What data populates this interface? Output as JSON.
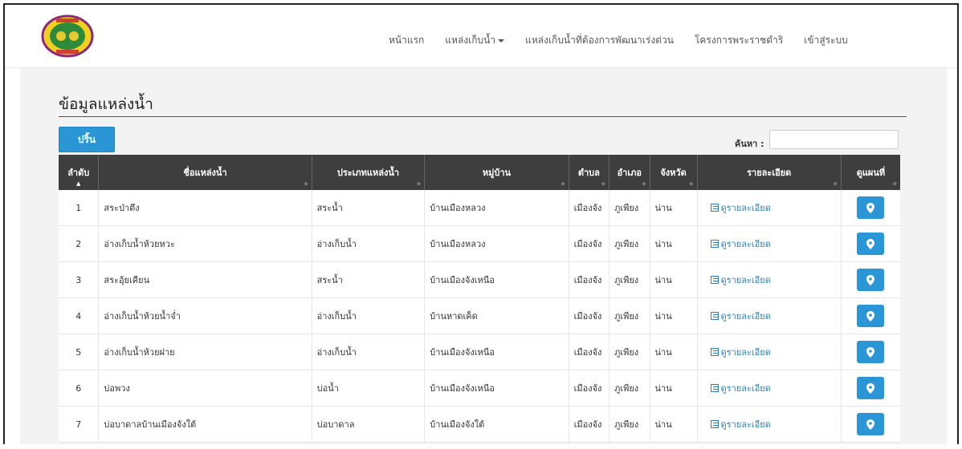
{
  "nav": {
    "items": [
      "หน้าแรก",
      "แหล่งเก็บน้ำ",
      "แหล่งเก็บน้ำที่ต้องการพัฒนาเร่งด่วน",
      "โครงการพระราชดำริ",
      "เข้าสู่ระบบ"
    ]
  },
  "page": {
    "title": "ข้อมูลแหล่งน้ำ",
    "print_label": "ปริ้น",
    "search_label": "ค้นหา :",
    "search_value": ""
  },
  "table": {
    "headers": [
      "ลำดับ",
      "ชื่อแหล่งน้ำ",
      "ประเภทแหล่งน้ำ",
      "หมู่บ้าน",
      "ตำบล",
      "อำเภอ",
      "จังหวัด",
      "รายละเอียด",
      "ดูแผนที่"
    ],
    "detail_label": "ดูรายละเอียด",
    "rows": [
      {
        "no": "1",
        "name": "สระป่าตึง",
        "type": "สระน้ำ",
        "village": "บ้านเมืองหลวง",
        "subdistrict": "เมืองจัง",
        "district": "ภูเพียง",
        "province": "น่าน"
      },
      {
        "no": "2",
        "name": "อ่างเก็บน้ำห้วยหวะ",
        "type": "อ่างเก็บน้ำ",
        "village": "บ้านเมืองหลวง",
        "subdistrict": "เมืองจัง",
        "district": "ภูเพียง",
        "province": "น่าน"
      },
      {
        "no": "3",
        "name": "สระอุ้ยเคียน",
        "type": "สระน้ำ",
        "village": "บ้านเมืองจังเหนือ",
        "subdistrict": "เมืองจัง",
        "district": "ภูเพียง",
        "province": "น่าน"
      },
      {
        "no": "4",
        "name": "อ่างเก็บน้ำห้วยน้ำจ่ำ",
        "type": "อ่างเก็บน้ำ",
        "village": "บ้านหาดเค็ด",
        "subdistrict": "เมืองจัง",
        "district": "ภูเพียง",
        "province": "น่าน"
      },
      {
        "no": "5",
        "name": "อ่างเก็บน้ำห้วยฝาย",
        "type": "อ่างเก็บน้ำ",
        "village": "บ้านเมืองจังเหนือ",
        "subdistrict": "เมืองจัง",
        "district": "ภูเพียง",
        "province": "น่าน"
      },
      {
        "no": "6",
        "name": "บ่อพวง",
        "type": "บ่อน้ำ",
        "village": "บ้านเมืองจังเหนือ",
        "subdistrict": "เมืองจัง",
        "district": "ภูเพียง",
        "province": "น่าน"
      },
      {
        "no": "7",
        "name": "บ่อบาดาลบ้านเมืองจังใต้",
        "type": "บ่อบาดาล",
        "village": "บ้านเมืองจังใต้",
        "subdistrict": "เมืองจัง",
        "district": "ภูเพียง",
        "province": "น่าน"
      }
    ]
  },
  "colors": {
    "accent": "#2a96d6",
    "header_bg": "#3e3e3e",
    "link": "#2a7fc0"
  }
}
